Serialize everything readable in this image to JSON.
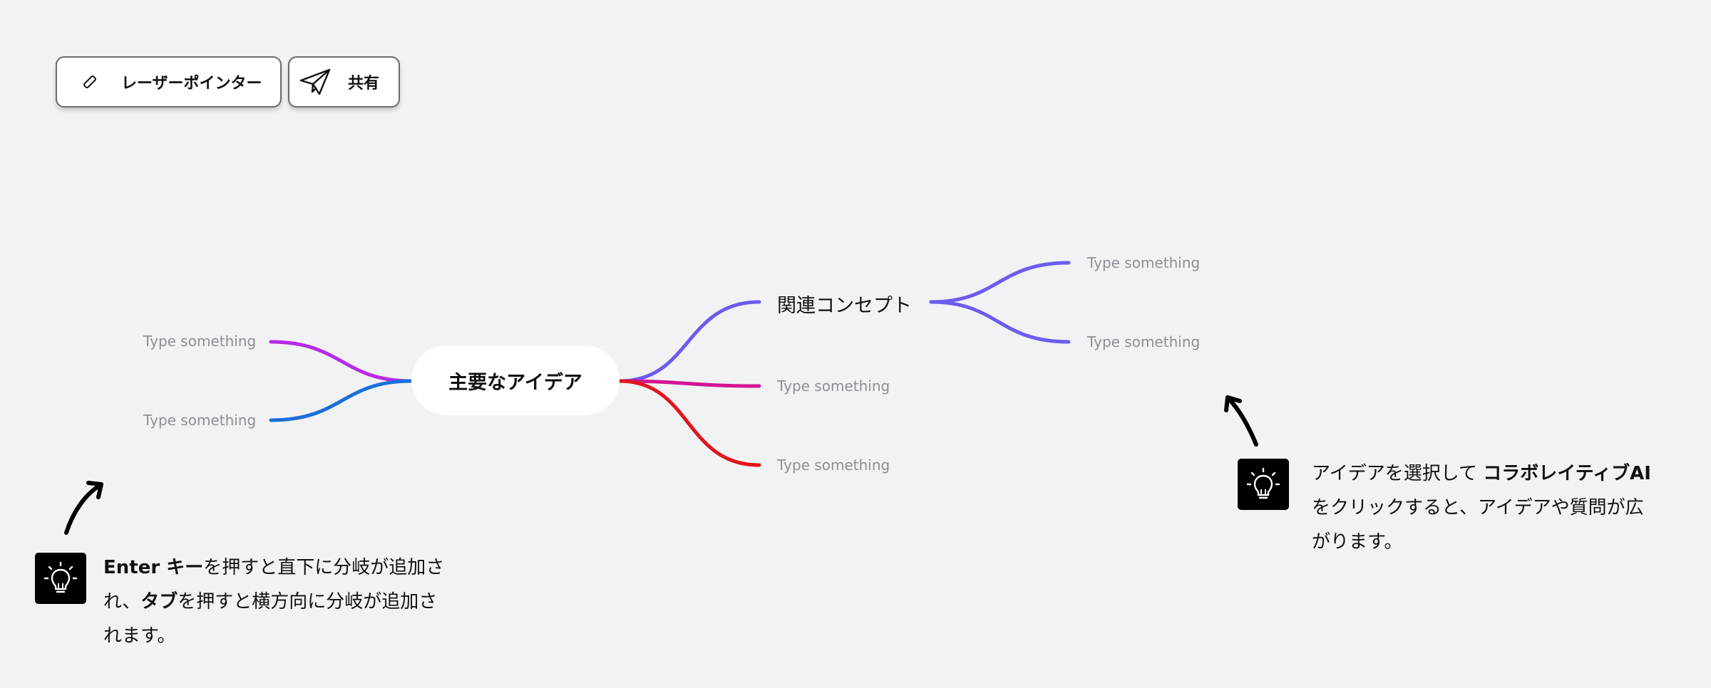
{
  "toolbar": {
    "laser_pointer_label": "レーザーポインター",
    "share_label": "共有"
  },
  "mindmap": {
    "central_label": "主要なアイデア",
    "concept_label": "関連コンセプト",
    "placeholder": "Type something",
    "branch_colors": {
      "concept": "#6b5cf0",
      "left_upper": "#b72be8",
      "left_lower": "#1a6fd8",
      "middle": "#d21690",
      "lower_right": "#e0161c"
    }
  },
  "tips": {
    "left": {
      "part1_bold": "Enter キー",
      "part2": "を押すと直下に分岐が追加さ",
      "part3": "れ、",
      "part4_bold": "タブ",
      "part5": "を押すと横方向に分岐が追加さ",
      "part6": "れます。"
    },
    "right": {
      "part1": "アイデアを選択して ",
      "part2_bold": "コラボレイティブAI",
      "part3": "をクリックすると、アイデアや質問が広",
      "part4": "がります。"
    }
  }
}
